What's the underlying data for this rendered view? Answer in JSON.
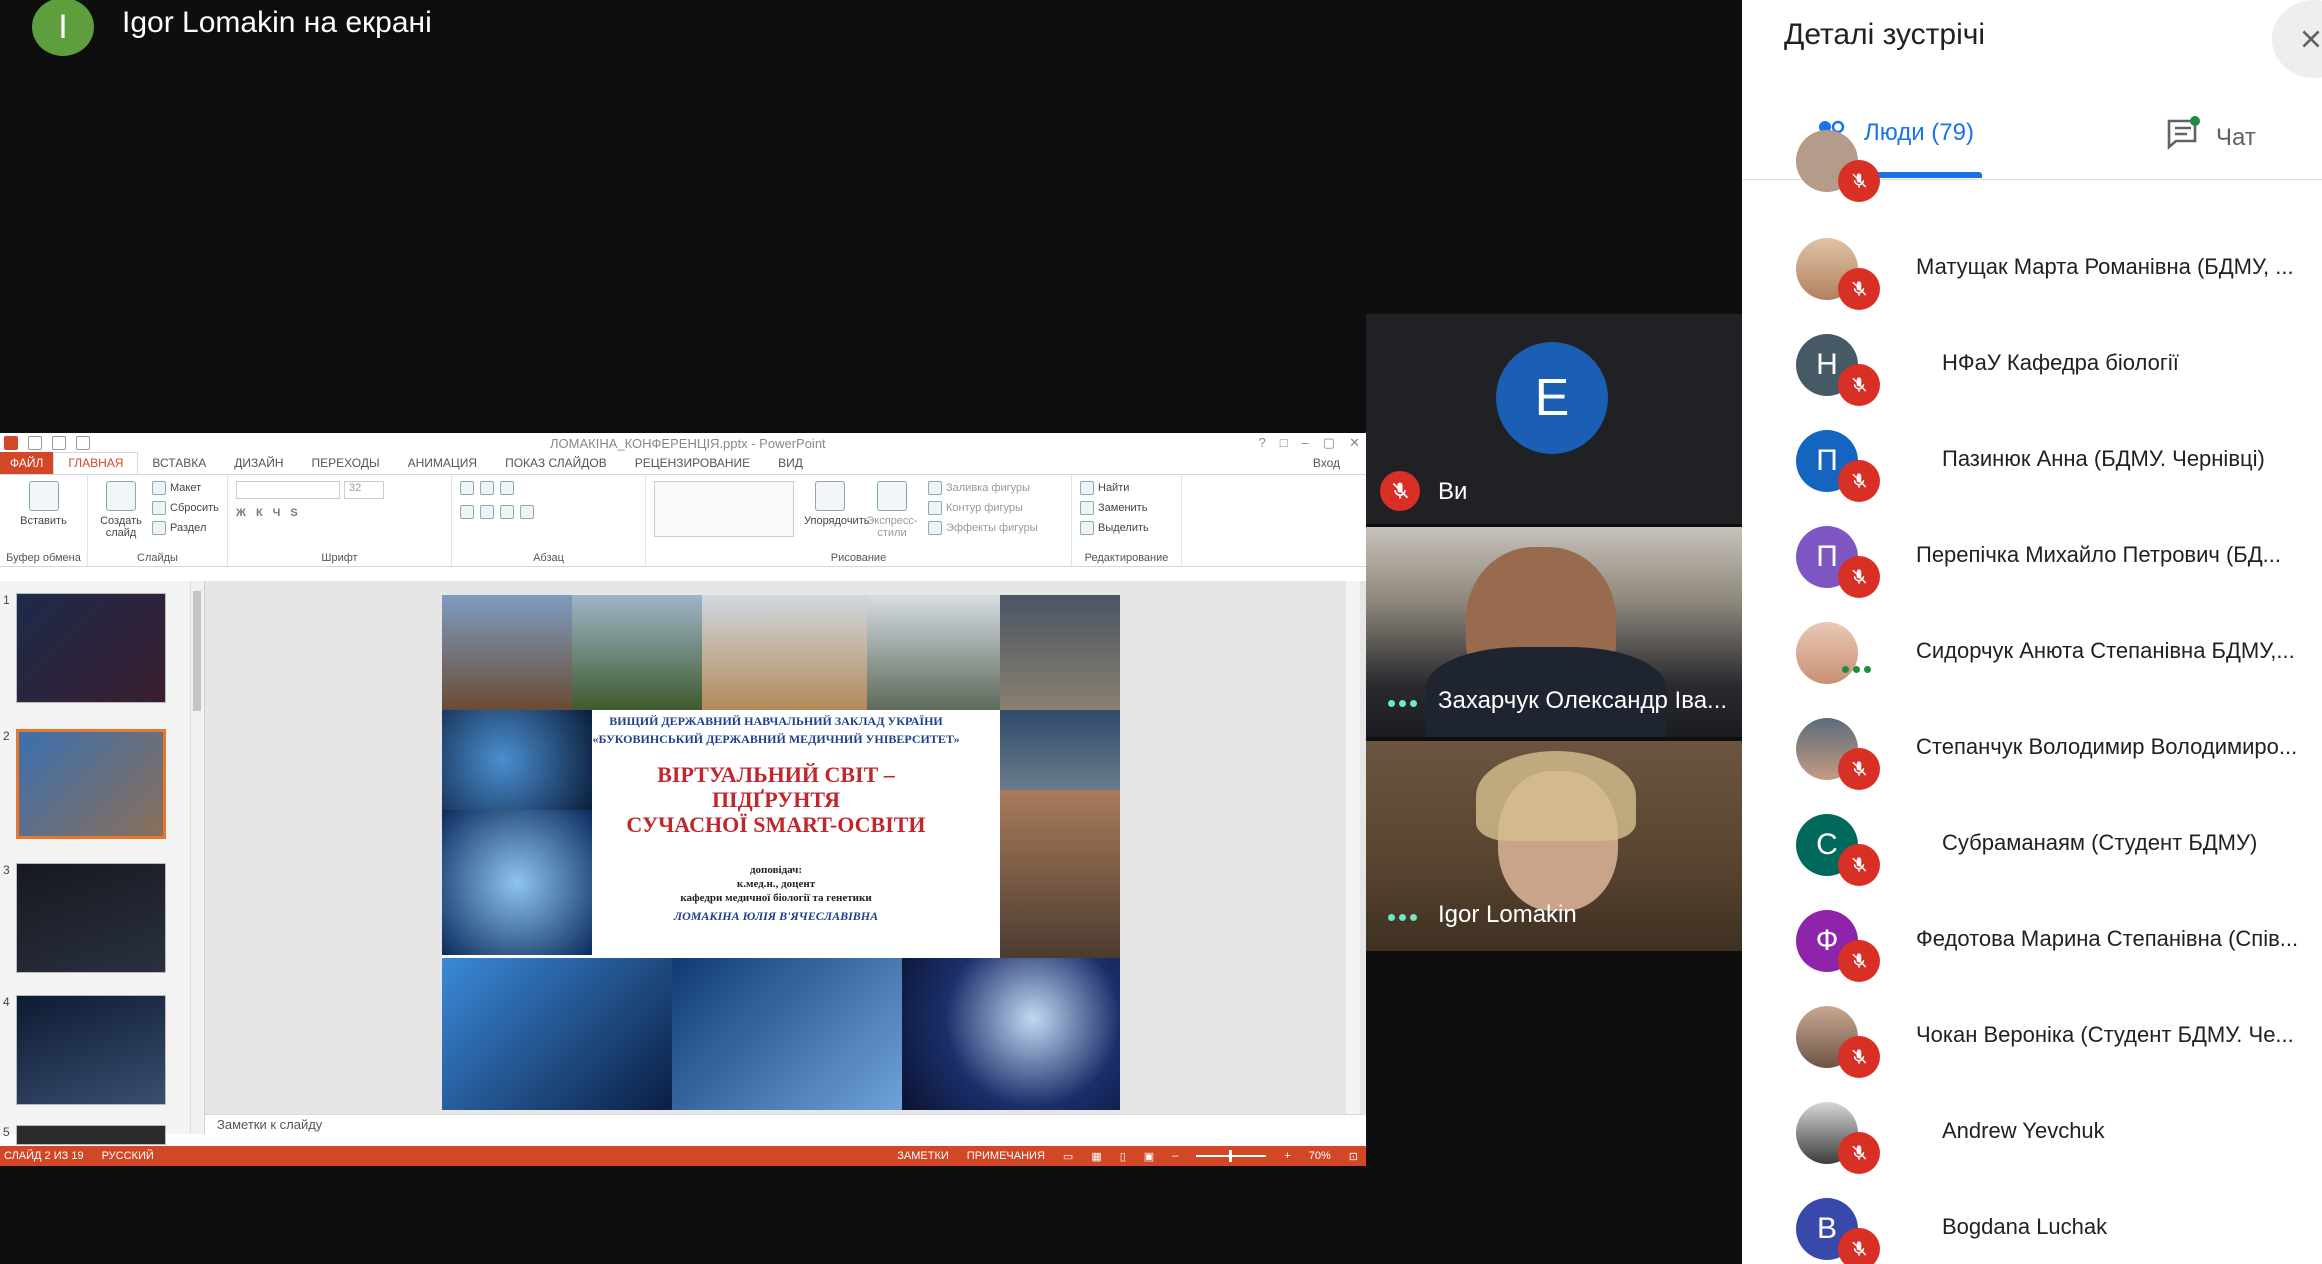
{
  "presenter": {
    "avatar_letter": "I",
    "label": "Igor Lomakin на екрані"
  },
  "powerpoint": {
    "doc_title": "ЛОМАКІНА_КОНФЕРЕНЦІЯ.pptx - PowerPoint",
    "window_controls": [
      "?",
      "□",
      "–",
      "▢",
      "✕"
    ],
    "tabs": [
      "ФАЙЛ",
      "ГЛАВНАЯ",
      "ВСТАВКА",
      "ДИЗАЙН",
      "ПЕРЕХОДЫ",
      "АНИМАЦИЯ",
      "ПОКАЗ СЛАЙДОВ",
      "РЕЦЕНЗИРОВАНИЕ",
      "ВИД"
    ],
    "login": "Вход",
    "ribbon": {
      "clipboard": {
        "paste": "Вставить",
        "group": "Буфер обмена"
      },
      "slides": {
        "new_slide": "Создать слайд",
        "layout": "Макет",
        "reset": "Сбросить",
        "section": "Раздел",
        "group": "Слайды"
      },
      "font": {
        "size": "32",
        "group": "Шрифт"
      },
      "paragraph": {
        "group": "Абзац"
      },
      "drawing": {
        "arrange": "Упорядочить",
        "quick_styles": "Экспресс-стили",
        "fill": "Заливка фигуры",
        "outline": "Контур фигуры",
        "effects": "Эффекты фигуры",
        "group": "Рисование"
      },
      "editing": {
        "find": "Найти",
        "replace": "Заменить",
        "select": "Выделить",
        "group": "Редактирование"
      }
    },
    "thumbnails": [
      {
        "num": "1"
      },
      {
        "num": "2"
      },
      {
        "num": "3"
      },
      {
        "num": "4"
      },
      {
        "num": "5"
      }
    ],
    "slide": {
      "institution_line1": "ВИЩИЙ ДЕРЖАВНИЙ НАВЧАЛЬНИЙ ЗАКЛАД УКРАЇНИ",
      "institution_line2": "«БУКОВИНСЬКИЙ ДЕРЖАВНИЙ МЕДИЧНИЙ УНІВЕРСИТЕТ»",
      "title_line1": "ВІРТУАЛЬНИЙ СВІТ – ПІДҐРУНТЯ",
      "title_line2": "СУЧАСНОЇ SMART-ОСВІТИ",
      "speaker_label": "доповідач:",
      "degree": "к.мед.н., доцент",
      "department": "кафедри медичної біології та генетики",
      "author": "ЛОМАКІНА ЮЛІЯ В'ЯЧЕСЛАВІВНА"
    },
    "notes_placeholder": "Заметки к слайду",
    "status": {
      "slide_counter": "СЛАЙД 2 ИЗ 19",
      "language": "РУССКИЙ",
      "notes": "ЗАМЕТКИ",
      "comments": "ПРИМЕЧАНИЯ",
      "zoom": "70%"
    }
  },
  "video_tiles": {
    "you": {
      "avatar_letter": "E",
      "label": "Ви"
    },
    "participants": [
      {
        "name": "Захарчук Олександр Іва..."
      },
      {
        "name": "Igor Lomakin"
      }
    ]
  },
  "panel": {
    "title": "Деталі зустрічі",
    "tabs": {
      "people": "Люди (79)",
      "chat": "Чат"
    },
    "people": [
      {
        "name": "Матущак Марта Романівна (БДМУ, ...",
        "avatar_letter": "",
        "avatar_color": "#c9a27a",
        "muted": true
      },
      {
        "name": "НФаУ Кафедра біології",
        "avatar_letter": "Н",
        "avatar_color": "#455a64",
        "muted": true
      },
      {
        "name": "Пазинюк Анна (БДМУ. Чернівці)",
        "avatar_letter": "П",
        "avatar_color": "#1565c0",
        "muted": true
      },
      {
        "name": "Перепічка Михайло Петрович (БД...",
        "avatar_letter": "П",
        "avatar_color": "#7e57c2",
        "muted": true
      },
      {
        "name": "Сидорчук Анюта Степанівна БДМУ,...",
        "avatar_letter": "",
        "avatar_color": "#d7a98c",
        "muted": false
      },
      {
        "name": "Степанчук Володимир Володимиро...",
        "avatar_letter": "",
        "avatar_color": "#6d7d8c",
        "muted": true
      },
      {
        "name": "Субраманаям (Студент БДМУ)",
        "avatar_letter": "С",
        "avatar_color": "#00695c",
        "muted": true
      },
      {
        "name": "Федотова Марина Степанівна (Спів...",
        "avatar_letter": "Ф",
        "avatar_color": "#8e24aa",
        "muted": true
      },
      {
        "name": "Чокан Вероніка (Студент БДМУ. Че...",
        "avatar_letter": "",
        "avatar_color": "#a1887f",
        "muted": true
      },
      {
        "name": "Andrew Yevchuk",
        "avatar_letter": "",
        "avatar_color": "#5d5d5d",
        "muted": true
      },
      {
        "name": "Bogdana Luchak",
        "avatar_letter": "B",
        "avatar_color": "#3949ab",
        "muted": true
      }
    ]
  }
}
